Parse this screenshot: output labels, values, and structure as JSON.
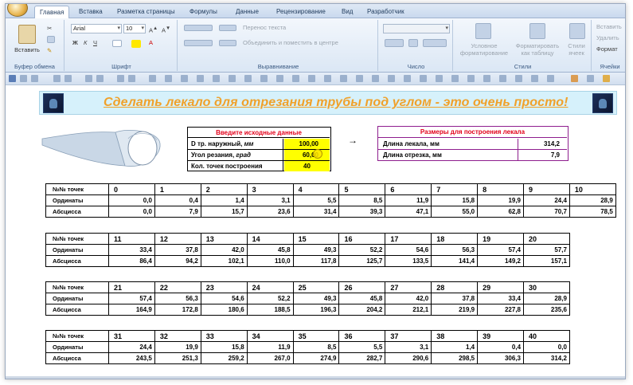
{
  "tabs": [
    "Главная",
    "Вставка",
    "Разметка страницы",
    "Формулы",
    "Данные",
    "Рецензирование",
    "Вид",
    "Разработчик"
  ],
  "ribbon": {
    "clipboard": {
      "label": "Буфер обмена",
      "paste": "Вставить"
    },
    "font": {
      "label": "Шрифт",
      "name": "Arial",
      "size": "10"
    },
    "alignment": {
      "label": "Выравнивание",
      "wrap": "Перенос текста",
      "merge": "Объединить и поместить в центре"
    },
    "number": {
      "label": "Число"
    },
    "styles": {
      "label": "Стили",
      "conditional_1": "Условное",
      "conditional_2": "форматирование",
      "table_1": "Форматировать",
      "table_2": "как таблицу",
      "cell_1": "Стили",
      "cell_2": "ячеек"
    },
    "cells": {
      "label": "Ячейки",
      "insert": "Вставить",
      "delete": "Удалить",
      "format": "Формат"
    }
  },
  "banner": {
    "title": "Сделать лекало для отрезания трубы под углом - это очень просто!"
  },
  "inputs": {
    "title": "Введите исходные данные",
    "rows": [
      {
        "label": "D тр. наружный, ",
        "unit": "мм",
        "value": "100,00"
      },
      {
        "label": "Угол резания, ",
        "unit": "град",
        "value": "60,00"
      },
      {
        "label": "Кол. точек построения",
        "unit": "",
        "value": "40"
      }
    ]
  },
  "arrow": "→",
  "outputs": {
    "title": "Размеры для построения лекала",
    "rows": [
      {
        "label": "Длина лекала, мм",
        "value": "314,2"
      },
      {
        "label": "Длина отрезка, мм",
        "value": "7,9"
      }
    ]
  },
  "tables": [
    {
      "header_label": "№№ точек",
      "ord_label": "Ординаты",
      "abs_label": "Абсцисса",
      "points": [
        "0",
        "1",
        "2",
        "3",
        "4",
        "5",
        "6",
        "7",
        "8",
        "9",
        "10"
      ],
      "ordinates": [
        "0,0",
        "0,4",
        "1,4",
        "3,1",
        "5,5",
        "8,5",
        "11,9",
        "15,8",
        "19,9",
        "24,4",
        "28,9"
      ],
      "abscissas": [
        "0,0",
        "7,9",
        "15,7",
        "23,6",
        "31,4",
        "39,3",
        "47,1",
        "55,0",
        "62,8",
        "70,7",
        "78,5"
      ]
    },
    {
      "header_label": "№№ точек",
      "ord_label": "Ординаты",
      "abs_label": "Абсцисса",
      "points": [
        "11",
        "12",
        "13",
        "14",
        "15",
        "16",
        "17",
        "18",
        "19",
        "20"
      ],
      "ordinates": [
        "33,4",
        "37,8",
        "42,0",
        "45,8",
        "49,3",
        "52,2",
        "54,6",
        "56,3",
        "57,4",
        "57,7"
      ],
      "abscissas": [
        "86,4",
        "94,2",
        "102,1",
        "110,0",
        "117,8",
        "125,7",
        "133,5",
        "141,4",
        "149,2",
        "157,1"
      ]
    },
    {
      "header_label": "№№ точек",
      "ord_label": "Ординаты",
      "abs_label": "Абсцисса",
      "points": [
        "21",
        "22",
        "23",
        "24",
        "25",
        "26",
        "27",
        "28",
        "29",
        "30"
      ],
      "ordinates": [
        "57,4",
        "56,3",
        "54,6",
        "52,2",
        "49,3",
        "45,8",
        "42,0",
        "37,8",
        "33,4",
        "28,9"
      ],
      "abscissas": [
        "164,9",
        "172,8",
        "180,6",
        "188,5",
        "196,3",
        "204,2",
        "212,1",
        "219,9",
        "227,8",
        "235,6"
      ]
    },
    {
      "header_label": "№№ точек",
      "ord_label": "Ординаты",
      "abs_label": "Абсцисса",
      "points": [
        "31",
        "32",
        "33",
        "34",
        "35",
        "36",
        "37",
        "38",
        "39",
        "40"
      ],
      "ordinates": [
        "24,4",
        "19,9",
        "15,8",
        "11,9",
        "8,5",
        "5,5",
        "3,1",
        "1,4",
        "0,4",
        "0,0"
      ],
      "abscissas": [
        "243,5",
        "251,3",
        "259,2",
        "267,0",
        "274,9",
        "282,7",
        "290,6",
        "298,5",
        "306,3",
        "314,2"
      ]
    }
  ]
}
